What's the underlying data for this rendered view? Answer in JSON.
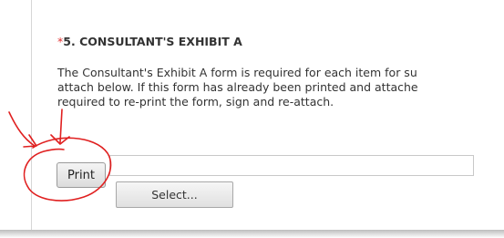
{
  "section": {
    "required_marker": "*",
    "number": "5.",
    "title": "CONSULTANT'S EXHIBIT A"
  },
  "description": {
    "lines": [
      "The Consultant's Exhibit A form is required for each item for su",
      "attach below. If this form has already been printed and attache",
      "required to re-print the form, sign and re-attach."
    ]
  },
  "buttons": {
    "print_label": "Print",
    "select_label": "Select..."
  },
  "file_field": {
    "value": ""
  },
  "colors": {
    "required_marker": "#e03030",
    "annotation": "#e02020"
  }
}
